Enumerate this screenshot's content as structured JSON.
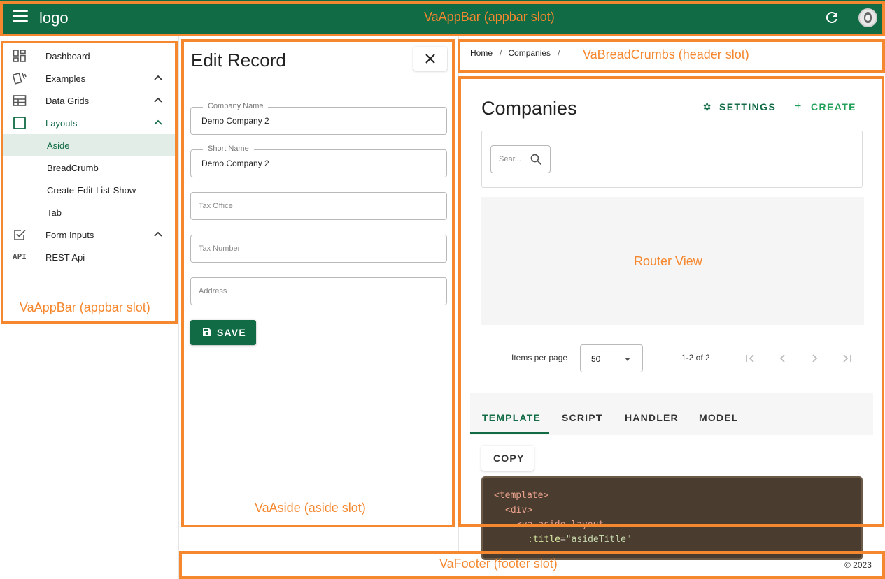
{
  "appbar": {
    "logo": "logo"
  },
  "sidebar": {
    "items": [
      {
        "label": "Dashboard",
        "icon": "dashboard-icon"
      },
      {
        "label": "Examples",
        "icon": "cards-icon"
      },
      {
        "label": "Data Grids",
        "icon": "table-icon"
      },
      {
        "label": "Layouts",
        "icon": "square-icon"
      },
      {
        "label": "Aside",
        "icon": ""
      },
      {
        "label": "BreadCrumb",
        "icon": ""
      },
      {
        "label": "Create-Edit-List-Show",
        "icon": ""
      },
      {
        "label": "Tab",
        "icon": ""
      },
      {
        "label": "Form Inputs",
        "icon": "checkbox-icon"
      },
      {
        "label": "REST Api",
        "icon": "api-icon"
      }
    ],
    "api_icon_text": "API",
    "accent_color": "#116b45"
  },
  "aside": {
    "title": "Edit Record",
    "fields": [
      {
        "label": "Company Name",
        "value": "Demo Company 2",
        "placeholder": ""
      },
      {
        "label": "Short Name",
        "value": "Demo Company 2",
        "placeholder": ""
      },
      {
        "label": "",
        "value": "",
        "placeholder": "Tax Office"
      },
      {
        "label": "",
        "value": "",
        "placeholder": "Tax Number"
      },
      {
        "label": "",
        "value": "",
        "placeholder": "Address"
      }
    ],
    "save_label": "SAVE"
  },
  "breadcrumbs": [
    "Home",
    "Companies"
  ],
  "main": {
    "title": "Companies",
    "settings_label": "SETTINGS",
    "create_label": "CREATE",
    "search_placeholder": "Sear...",
    "pager": {
      "items_per_page_label": "Items per page",
      "items_per_page": "50",
      "range": "1-2 of 2"
    },
    "tabs": [
      {
        "label": "TEMPLATE"
      },
      {
        "label": "SCRIPT"
      },
      {
        "label": "HANDLER"
      },
      {
        "label": "MODEL"
      }
    ],
    "copy_label": "COPY",
    "code": {
      "line1": "<template>",
      "line2": "<div>",
      "line3": "<va-aside-layout",
      "line4_attr": ":title",
      "line4_eq": "=",
      "line4_val": "\"asideTitle\""
    }
  },
  "footer": {
    "copyright": "© 2023"
  },
  "annotations": {
    "appbar": "VaAppBar (appbar slot)",
    "menu": "VaAppBar (appbar slot)",
    "aside": "VaAside (aside slot)",
    "header": "VaBreadCrumbs (header slot)",
    "router": "Router View",
    "footer": "VaFooter (footer slot)"
  },
  "colors": {
    "primary": "#116b45",
    "annotation": "#f5872e",
    "success": "#22a05a"
  }
}
